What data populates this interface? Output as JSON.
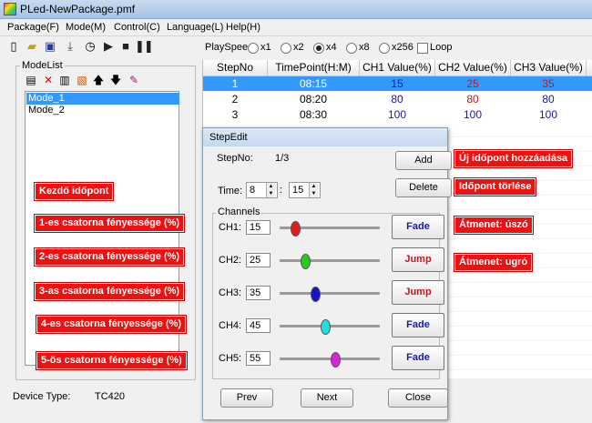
{
  "window": {
    "title": "PLed-NewPackage.pmf"
  },
  "menu": [
    "Package(F)",
    "Mode(M)",
    "Control(C)",
    "Language(L)",
    "Help(H)"
  ],
  "toolbar": {
    "play_speed_label": "PlaySpeed:",
    "speeds": [
      {
        "label": "x1",
        "selected": false
      },
      {
        "label": "x2",
        "selected": false
      },
      {
        "label": "x4",
        "selected": true
      },
      {
        "label": "x8",
        "selected": false
      },
      {
        "label": "x256",
        "selected": false
      }
    ],
    "loop_label": "Loop",
    "loop_checked": false
  },
  "modelist": {
    "title": "ModeList",
    "items": [
      {
        "label": "Mode_1",
        "selected": true
      },
      {
        "label": "Mode_2",
        "selected": false
      }
    ]
  },
  "device": {
    "label": "Device Type:",
    "value": "TC420"
  },
  "table": {
    "headers": [
      "StepNo",
      "TimePoint(H:M)",
      "CH1 Value(%)",
      "CH2 Value(%)",
      "CH3 Value(%)"
    ],
    "rows": [
      {
        "step": "1",
        "time": "08:15",
        "ch1": "15",
        "ch2": "25",
        "ch3": "35",
        "selected": true
      },
      {
        "step": "2",
        "time": "08:20",
        "ch1": "80",
        "ch2": "80",
        "ch3": "80",
        "selected": false
      },
      {
        "step": "3",
        "time": "08:30",
        "ch1": "100",
        "ch2": "100",
        "ch3": "100",
        "selected": false
      }
    ]
  },
  "dialog": {
    "title": "StepEdit",
    "step_label": "StepNo:",
    "step_value": "1/3",
    "add_label": "Add",
    "delete_label": "Delete",
    "time_label": "Time:",
    "hour": "8",
    "minute": "15",
    "channels_title": "Channels",
    "channels": [
      {
        "label": "CH1:",
        "value": "15",
        "level": 15,
        "color": "#e21c1c",
        "mode": "Fade",
        "mode_color": "#1a1aa0"
      },
      {
        "label": "CH2:",
        "value": "25",
        "level": 25,
        "color": "#22cc22",
        "mode": "Jump",
        "mode_color": "#c0171f"
      },
      {
        "label": "CH3:",
        "value": "35",
        "level": 35,
        "color": "#1414cc",
        "mode": "Jump",
        "mode_color": "#c0171f"
      },
      {
        "label": "CH4:",
        "value": "45",
        "level": 45,
        "color": "#22dddd",
        "mode": "Fade",
        "mode_color": "#1a1aa0"
      },
      {
        "label": "CH5:",
        "value": "55",
        "level": 55,
        "color": "#dd22dd",
        "mode": "Fade",
        "mode_color": "#1a1aa0"
      }
    ],
    "prev_label": "Prev",
    "next_label": "Next",
    "close_label": "Close"
  },
  "annotations": {
    "start_time": "Kezdő időpont",
    "ch1": "1-es csatorna fényessége (%)",
    "ch2": "2-es csatorna fényessége (%)",
    "ch3": "3-as csatorna fényessége (%)",
    "ch4": "4-es csatorna fényessége (%)",
    "ch5": "5-ös csatorna fényessége (%)",
    "add": "Új időpont hozzáadása",
    "delete": "Időpont törlése",
    "fade": "Átmenet: úszó",
    "jump": "Átmenet: ugró"
  },
  "colors": {
    "selection": "#3399ff",
    "annotation": "#ee1111",
    "ch1_text": "#1a1aa0",
    "ch2_text": "#c0171f"
  }
}
